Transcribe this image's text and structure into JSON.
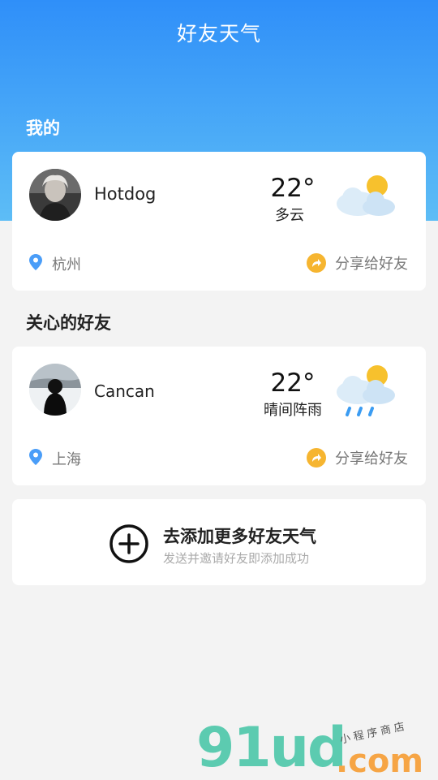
{
  "header": {
    "title": "好友天气"
  },
  "sections": {
    "mine": "我的",
    "friends": "关心的好友"
  },
  "me": {
    "name": "Hotdog",
    "temp": "22°",
    "condition": "多云",
    "location": "杭州",
    "share_label": "分享给好友",
    "weather_icon": "partly-cloudy"
  },
  "friend": {
    "name": "Cancan",
    "temp": "22°",
    "condition": "晴间阵雨",
    "location": "上海",
    "share_label": "分享给好友",
    "weather_icon": "sun-shower"
  },
  "add_friend": {
    "title": "去添加更多好友天气",
    "subtitle": "发送并邀请好友即添加成功"
  },
  "watermark": {
    "brand": "91ud",
    "domain": ".com",
    "tagline": "小程序商店"
  },
  "colors": {
    "header_top": "#2f8ff9",
    "header_bottom": "#5dbdf6",
    "share_accent": "#f6b530",
    "location_pin": "#4a9df8",
    "sun": "#f7c12d"
  }
}
